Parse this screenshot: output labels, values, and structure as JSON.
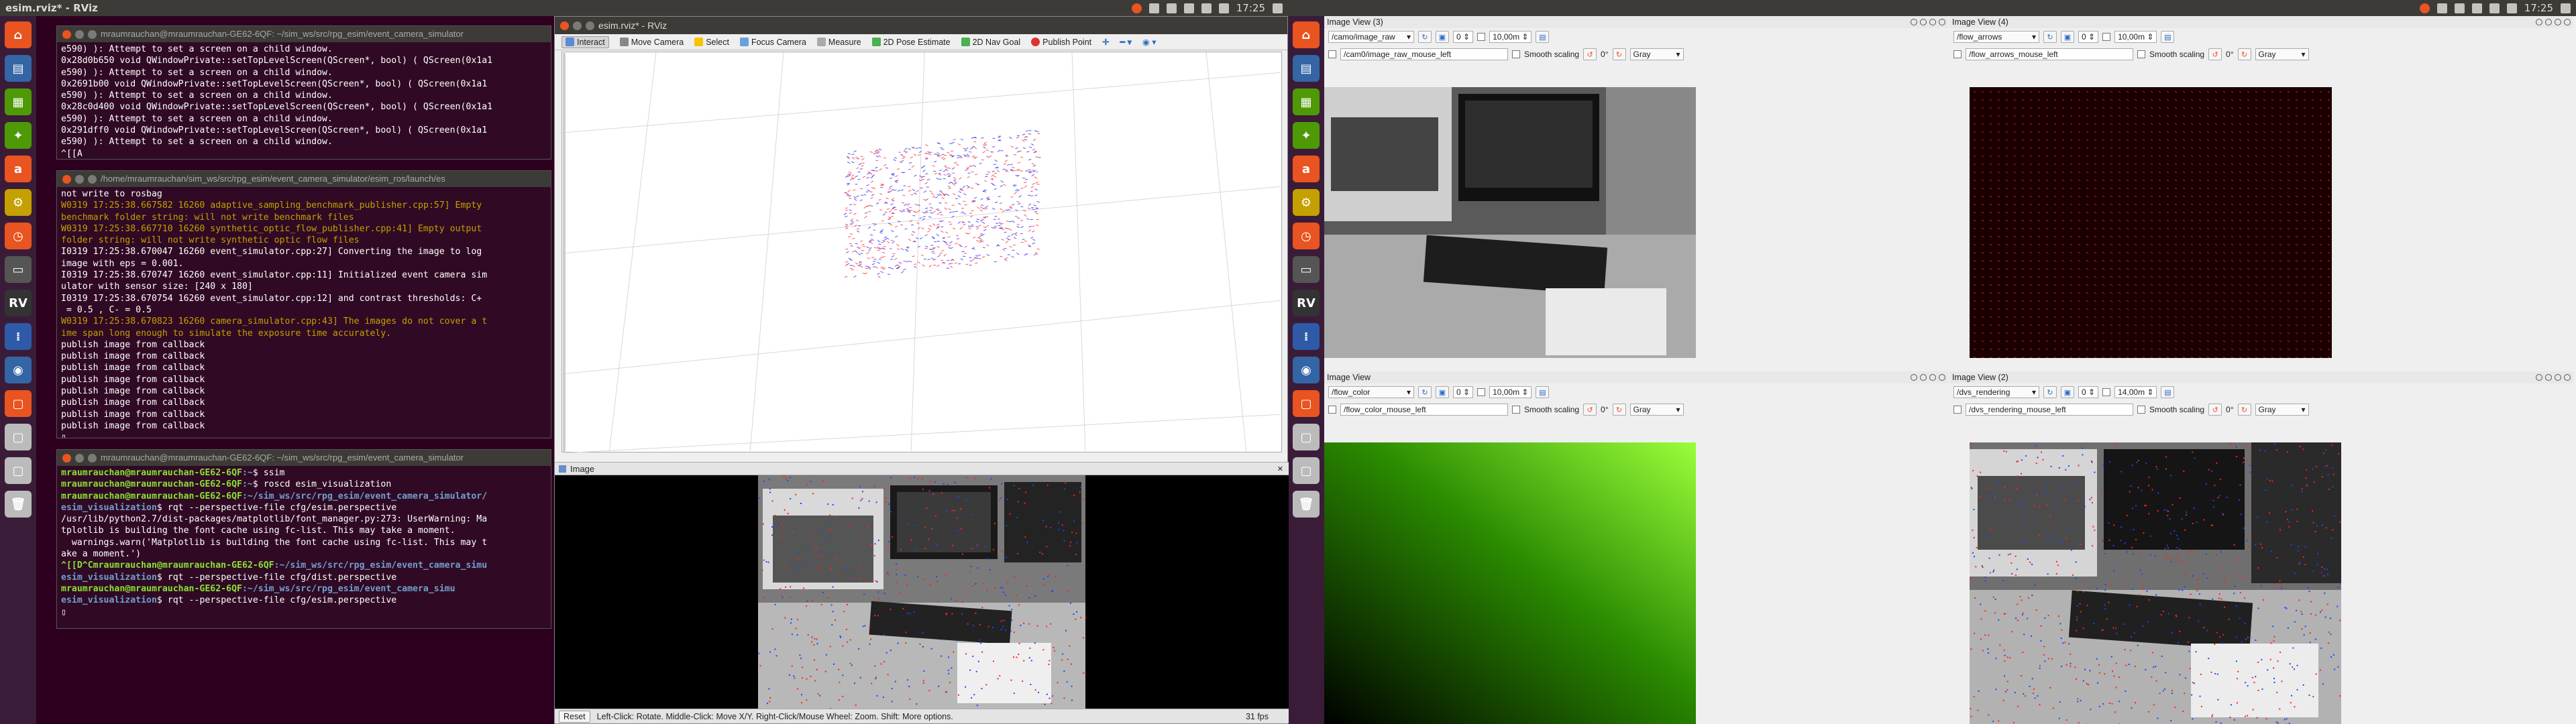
{
  "topbar_left": {
    "title": "esim.rviz* - RViz",
    "time": "17:25"
  },
  "topbar_right": {
    "time": "17:25"
  },
  "launcher_left": [
    "⌂",
    "▤",
    "▦",
    "✦",
    "a",
    "⚙",
    "◷",
    "▭",
    "RV",
    "⁞",
    "◉",
    "▢",
    "▢",
    "▢",
    "🗑"
  ],
  "terminal1": {
    "title": "mraumrauchan@mraumrauchan-GE62-6QF: ~/sim_ws/src/rpg_esim/event_camera_simulator",
    "lines": [
      "e590) ): Attempt to set a screen on a child window.",
      "0x28d0b650 void QWindowPrivate::setTopLevelScreen(QScreen*, bool) ( QScreen(0x1a1",
      "e590) ): Attempt to set a screen on a child window.",
      "0x2691b00 void QWindowPrivate::setTopLevelScreen(QScreen*, bool) ( QScreen(0x1a1",
      "e590) ): Attempt to set a screen on a child window.",
      "0x28c0d400 void QWindowPrivate::setTopLevelScreen(QScreen*, bool) ( QScreen(0x1a1",
      "e590) ): Attempt to set a screen on a child window.",
      "0x291dff0 void QWindowPrivate::setTopLevelScreen(QScreen*, bool) ( QScreen(0x1a1",
      "e590) ): Attempt to set a screen on a child window.",
      "^[[A"
    ]
  },
  "terminal2": {
    "title": "/home/mraumrauchan/sim_ws/src/rpg_esim/event_camera_simulator/esim_ros/launch/es",
    "lines": [
      {
        "t": "not write to rosbag",
        "c": ""
      },
      {
        "t": "W0319 17:25:38.667582 16260 adaptive_sampling_benchmark_publisher.cpp:57] Empty",
        "c": "warn"
      },
      {
        "t": "benchmark folder string: will not write benchmark files",
        "c": "warn"
      },
      {
        "t": "W0319 17:25:38.667710 16260 synthetic_optic_flow_publisher.cpp:41] Empty output",
        "c": "warn"
      },
      {
        "t": "folder string: will not write synthetic optic flow files",
        "c": "warn"
      },
      {
        "t": "I0319 17:25:38.670047 16260 event_simulator.cpp:27] Converting the image to log",
        "c": ""
      },
      {
        "t": "image with eps = 0.001.",
        "c": ""
      },
      {
        "t": "I0319 17:25:38.670747 16260 event_simulator.cpp:11] Initialized event camera sim",
        "c": ""
      },
      {
        "t": "ulator with sensor size: [240 x 180]",
        "c": ""
      },
      {
        "t": "I0319 17:25:38.670754 16260 event_simulator.cpp:12] and contrast thresholds: C+",
        "c": ""
      },
      {
        "t": " = 0.5 , C- = 0.5",
        "c": ""
      },
      {
        "t": "W0319 17:25:38.670823 16260 camera_simulator.cpp:43] The images do not cover a t",
        "c": "warn"
      },
      {
        "t": "ime span long enough to simulate the exposure time accurately.",
        "c": "warn"
      },
      {
        "t": "publish image from callback",
        "c": ""
      },
      {
        "t": "publish image from callback",
        "c": ""
      },
      {
        "t": "publish image from callback",
        "c": ""
      },
      {
        "t": "publish image from callback",
        "c": ""
      },
      {
        "t": "publish image from callback",
        "c": ""
      },
      {
        "t": "publish image from callback",
        "c": ""
      },
      {
        "t": "publish image from callback",
        "c": ""
      },
      {
        "t": "publish image from callback",
        "c": ""
      },
      {
        "t": "▯",
        "c": ""
      }
    ]
  },
  "terminal3": {
    "title": "mraumrauchan@mraumrauchan-GE62-6QF: ~/sim_ws/src/rpg_esim/event_camera_simulator",
    "lines": [
      {
        "p": "mraumrauchan@mraumrauchan-GE62-6QF",
        "d": ":~",
        "t": "$ ssim"
      },
      {
        "p": "mraumrauchan@mraumrauchan-GE62-6QF",
        "d": ":~",
        "t": "$ roscd esim_visualization"
      },
      {
        "p": "mraumrauchan@mraumrauchan-GE62-6QF",
        "d": ":~/sim_ws/src/rpg_esim/event_camera_simulator/",
        "t": ""
      },
      {
        "p": "",
        "d": "esim_visualization",
        "t": "$ rqt --perspective-file cfg/esim.perspective"
      },
      {
        "p": "",
        "d": "",
        "t": "/usr/lib/python2.7/dist-packages/matplotlib/font_manager.py:273: UserWarning: Ma"
      },
      {
        "p": "",
        "d": "",
        "t": "tplotlib is building the font cache using fc-list. This may take a moment."
      },
      {
        "p": "",
        "d": "",
        "t": "  warnings.warn('Matplotlib is building the font cache using fc-list. This may t"
      },
      {
        "p": "",
        "d": "",
        "t": "ake a moment.')"
      },
      {
        "p": "^[[D^Cmraumrauchan@mraumrauchan-GE62-6QF",
        "d": ":~/sim_ws/src/rpg_esim/event_camera_simu",
        "t": ""
      },
      {
        "p": "",
        "d": "esim_visualization",
        "t": "$ rqt --perspective-file cfg/dist.perspective"
      },
      {
        "p": "mraumrauchan@mraumrauchan-GE62-6QF",
        "d": ":~/sim_ws/src/rpg_esim/event_camera_simu",
        "t": ""
      },
      {
        "p": "",
        "d": "esim_visualization",
        "t": "$ rqt --perspective-file cfg/esim.perspective"
      },
      {
        "p": "",
        "d": "",
        "t": "▯"
      }
    ]
  },
  "rviz": {
    "title": "esim.rviz* - RViz",
    "tools": [
      "Interact",
      "Move Camera",
      "Select",
      "Focus Camera",
      "Measure",
      "2D Pose Estimate",
      "2D Nav Goal",
      "Publish Point"
    ],
    "image_panel_title": "Image",
    "status": {
      "reset": "Reset",
      "help": "Left-Click: Rotate. Middle-Click: Move X/Y. Right-Click/Mouse Wheel: Zoom. Shift: More options.",
      "fps": "31 fps"
    }
  },
  "rqt": {
    "panes": [
      {
        "title": "Image View (3)",
        "topic": "/camo/image_raw",
        "n1": "0",
        "range": "10,00m",
        "mouse": "/cam0/image_raw_mouse_left",
        "smooth": "Smooth scaling",
        "deg": "0°",
        "cmap": "Gray"
      },
      {
        "title": "Image View (4)",
        "topic": "/flow_arrows",
        "n1": "0",
        "range": "10,00m",
        "mouse": "/flow_arrows_mouse_left",
        "smooth": "Smooth scaling",
        "deg": "0°",
        "cmap": "Gray"
      },
      {
        "title": "Image View",
        "topic": "/flow_color",
        "n1": "0",
        "range": "10,00m",
        "mouse": "/flow_color_mouse_left",
        "smooth": "Smooth scaling",
        "deg": "0°",
        "cmap": "Gray"
      },
      {
        "title": "Image View (2)",
        "topic": "/dvs_rendering",
        "n1": "0",
        "range": "14,00m",
        "mouse": "/dvs_rendering_mouse_left",
        "smooth": "Smooth scaling",
        "deg": "0°",
        "cmap": "Gray"
      }
    ]
  },
  "colors": {
    "accent": "#e95420",
    "terminal_bg": "#300a24",
    "warn": "#c4a000",
    "prompt": "#8ae234",
    "path": "#729fcf"
  }
}
